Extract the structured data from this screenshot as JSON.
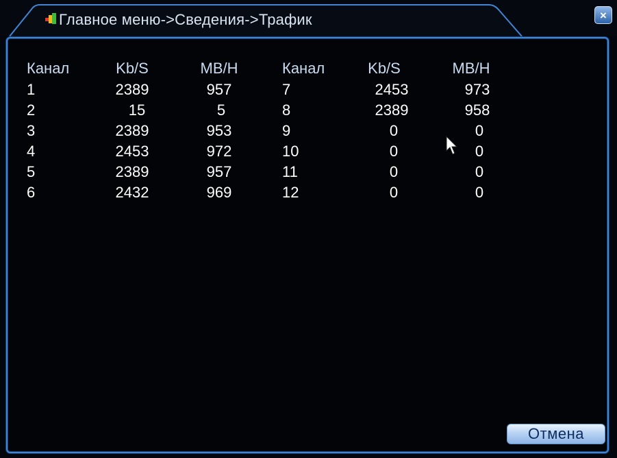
{
  "window": {
    "title": "Главное меню->Сведения->Трафик",
    "close_label": "×"
  },
  "table": {
    "headers": [
      "Канал",
      "Kb/S",
      "MB/H",
      "Канал",
      "Kb/S",
      "MB/H"
    ],
    "rows": [
      [
        "1",
        "2389",
        "957",
        "7",
        "2453",
        "973"
      ],
      [
        "2",
        "15",
        "5",
        "8",
        "2389",
        "958"
      ],
      [
        "3",
        "2389",
        "953",
        "9",
        "0",
        "0"
      ],
      [
        "4",
        "2453",
        "972",
        "10",
        "0",
        "0"
      ],
      [
        "5",
        "2389",
        "957",
        "11",
        "0",
        "0"
      ],
      [
        "6",
        "2432",
        "969",
        "12",
        "0",
        "0"
      ]
    ]
  },
  "footer": {
    "cancel_label": "Отмена"
  },
  "colors": {
    "accent": "#3f86d6",
    "background": "#03060c",
    "text": "#ffffff"
  },
  "icons": {
    "title_icon": "menu-app-icon",
    "close_icon": "close-icon",
    "cursor": "mouse-pointer-icon"
  }
}
